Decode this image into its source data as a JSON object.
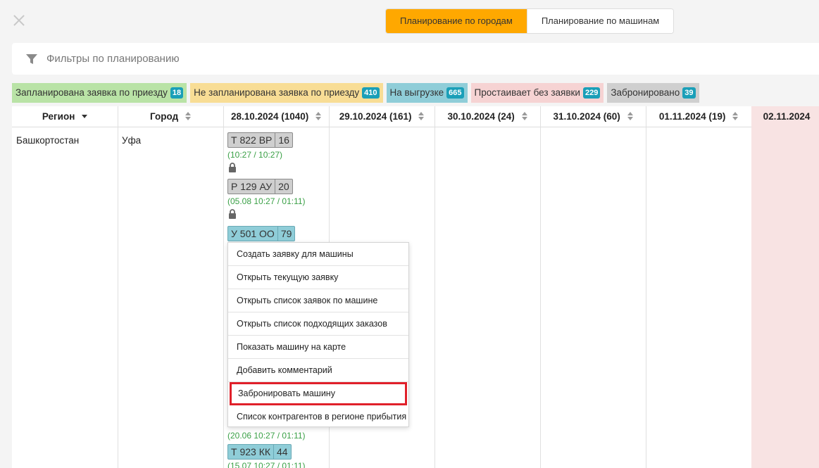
{
  "mode_switch": {
    "by_cities": "Планирование по городам",
    "by_trucks": "Планирование по машинам"
  },
  "filter": {
    "label": "Фильтры по планированию"
  },
  "legend": [
    {
      "label": "Запланирована заявка по приезду",
      "count": "18",
      "color": "#b9e3a6"
    },
    {
      "label": "Не запланирована заявка по приезду",
      "count": "410",
      "color": "#f8dd95"
    },
    {
      "label": "На выгрузке",
      "count": "665",
      "color": "#8fcdd8"
    },
    {
      "label": "Простаивает без заявки",
      "count": "229",
      "color": "#f6d3d3"
    },
    {
      "label": "Забронировано",
      "count": "39",
      "color": "#cfcfcf"
    }
  ],
  "table": {
    "columns": {
      "region": "Регион",
      "city": "Город",
      "d1": "28.10.2024 (1040)",
      "d2": "29.10.2024 (161)",
      "d3": "30.10.2024 (24)",
      "d4": "31.10.2024 (60)",
      "d5": "01.11.2024 (19)",
      "d6": "02.11.2024"
    },
    "row": {
      "region": "Башкортостан",
      "city": "Уфа"
    },
    "trucks": [
      {
        "plate": "Т 822 ВР",
        "num": "16",
        "time": "(10:27 / 10:27)"
      },
      {
        "plate": "Р 129 АУ",
        "num": "20",
        "time": "(05.08 10:27 / 01:11)"
      },
      {
        "plate": "У 501 ОО",
        "num": "79"
      },
      {
        "time": "(20.06 10:27 / 01:11)"
      },
      {
        "plate": "Т 923 КК",
        "num": "44",
        "time": "(15.07 10:27 / 01:11)"
      }
    ]
  },
  "context_menu": [
    "Создать заявку для машины",
    "Открыть текущую заявку",
    "Открыть список заявок по машине",
    "Открыть список подходящих заказов",
    "Показать машину на карте",
    "Добавить комментарий",
    "Забронировать машину",
    "Список контрагентов в регионе прибытия"
  ]
}
